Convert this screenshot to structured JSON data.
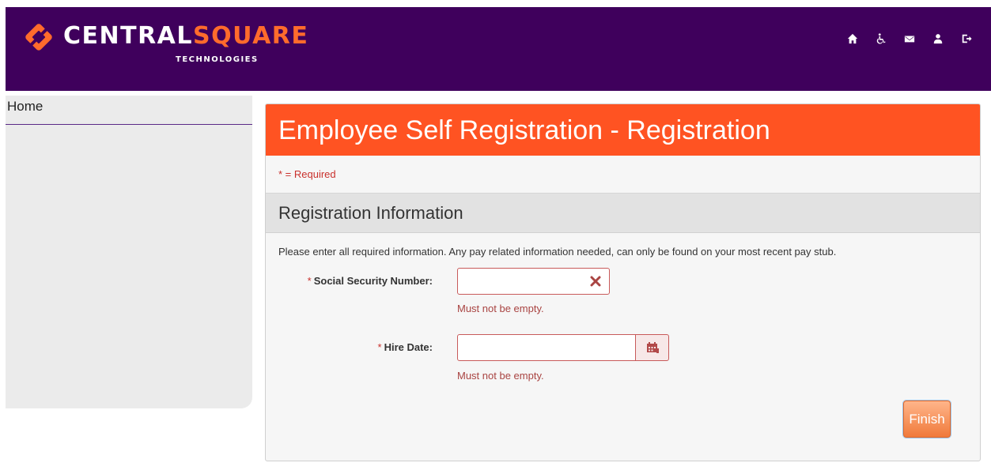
{
  "brand": {
    "name_part1": "CENTRAL",
    "name_part2": "SQUARE",
    "subtitle": "TECHNOLOGIES",
    "colors": {
      "header_bg": "#3f005c",
      "accent": "#ff5322",
      "brand_orange": "#ff6b2c"
    }
  },
  "header_icons": [
    "home-icon",
    "accessibility-icon",
    "mail-icon",
    "user-icon",
    "logout-icon"
  ],
  "sidebar": {
    "home_label": "Home"
  },
  "panel": {
    "title": "Employee Self Registration - Registration",
    "required_note": "* = Required",
    "section_title": "Registration Information",
    "instructions": "Please enter all required information. Any pay related information needed, can only be found on your most recent pay stub."
  },
  "form": {
    "ssn": {
      "required_mark": "*",
      "label": "Social Security Number:",
      "value": "",
      "error": "Must not be empty."
    },
    "hire_date": {
      "required_mark": "*",
      "label": "Hire Date:",
      "value": "",
      "error": "Must not be empty."
    }
  },
  "actions": {
    "finish_label": "Finish"
  }
}
